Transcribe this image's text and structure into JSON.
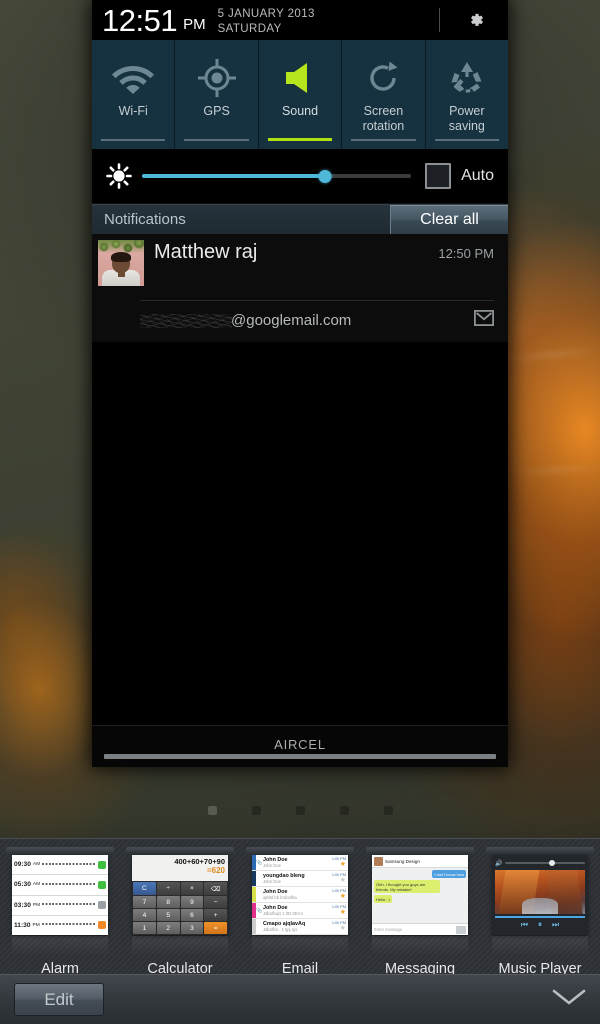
{
  "status_bar": {
    "time": "12:51",
    "ampm": "PM",
    "date": "5 JANUARY 2013",
    "day": "SATURDAY",
    "settings_icon": "gear-icon"
  },
  "quick_toggles": [
    {
      "label": "Wi-Fi",
      "icon": "wifi-icon",
      "active": false
    },
    {
      "label": "GPS",
      "icon": "gps-icon",
      "active": false
    },
    {
      "label": "Sound",
      "icon": "sound-icon",
      "active": true
    },
    {
      "label": "Screen\nrotation",
      "line1": "Screen",
      "line2": "rotation",
      "icon": "screen-rotation-icon",
      "active": false
    },
    {
      "label": "Power\nsaving",
      "line1": "Power",
      "line2": "saving",
      "icon": "power-saving-icon",
      "active": false
    }
  ],
  "brightness": {
    "icon": "brightness-icon",
    "value_percent": 68,
    "auto_label": "Auto",
    "auto_checked": false,
    "fill_color": "#4fb7d8"
  },
  "notifications_header": {
    "title": "Notifications",
    "clear_all_label": "Clear all"
  },
  "notification": {
    "title": "Matthew raj",
    "time": "12:50 PM",
    "account_domain": "@googlemail.com",
    "account_redacted": true,
    "app_icon": "gmail-icon",
    "avatar": "contact-photo"
  },
  "carrier": {
    "name": "AIRCEL"
  },
  "page_indicator": {
    "count": 5,
    "active_index": 0
  },
  "widgets": [
    {
      "label": "Alarm",
      "alarm_rows": [
        {
          "time": "09:30",
          "ampm": "AM",
          "state": "on"
        },
        {
          "time": "05:30",
          "ampm": "AM",
          "state": "on"
        },
        {
          "time": "03:30",
          "ampm": "PM",
          "state": "off"
        },
        {
          "time": "11:30",
          "ampm": "PM",
          "state": "orange"
        }
      ]
    },
    {
      "label": "Calculator",
      "expression": "400+60+70+90",
      "result": "=620",
      "keys": [
        "C",
        "÷",
        "×",
        "⌫",
        "7",
        "8",
        "9",
        "−",
        "4",
        "5",
        "6",
        "+",
        "1",
        "2",
        "3",
        "="
      ]
    },
    {
      "label": "Email",
      "rows": [
        {
          "from": "John Doe",
          "snippet": "John Doe",
          "time": "1:00 PM",
          "color": "#2d6ab4",
          "starred": true,
          "attachment": true
        },
        {
          "from": "youngdao bleng",
          "snippet": "John Doe",
          "time": "1:00 PM",
          "color": "#16375e",
          "starred": false,
          "attachment": false
        },
        {
          "from": "John Doe",
          "snippet": "ajMtd  bb  lrrdoofba",
          "time": "1:00 PM",
          "color": "#d8e04a",
          "starred": true,
          "attachment": false
        },
        {
          "from": "John Doe",
          "snippet": "Jdbofbaj1  1  0D  8DA4",
          "time": "1:00 PM",
          "color": "#e0308a",
          "starred": true,
          "attachment": true
        },
        {
          "from": "Cmapo ajqlavAq",
          "snippet": "Jdbofbo -  1 tjpj aj1",
          "time": "1:00 PM",
          "color": "#cccccc",
          "starred": false,
          "attachment": false
        }
      ]
    },
    {
      "label": "Messaging",
      "contact": "Samsung Design",
      "bubbles": [
        {
          "side": "me",
          "text": "I don't know how"
        },
        {
          "side": "you",
          "text": "Ohh, I thought you guys are friends. My mistake!"
        },
        {
          "side": "you",
          "text": "Hello : )"
        }
      ],
      "input_placeholder": "Enter message"
    },
    {
      "label": "Music Player",
      "volume_percent": 55,
      "controls": [
        "previous",
        "pause",
        "next"
      ]
    }
  ],
  "bottom_bar": {
    "edit_label": "Edit",
    "collapse_icon": "chevron-down-icon"
  }
}
